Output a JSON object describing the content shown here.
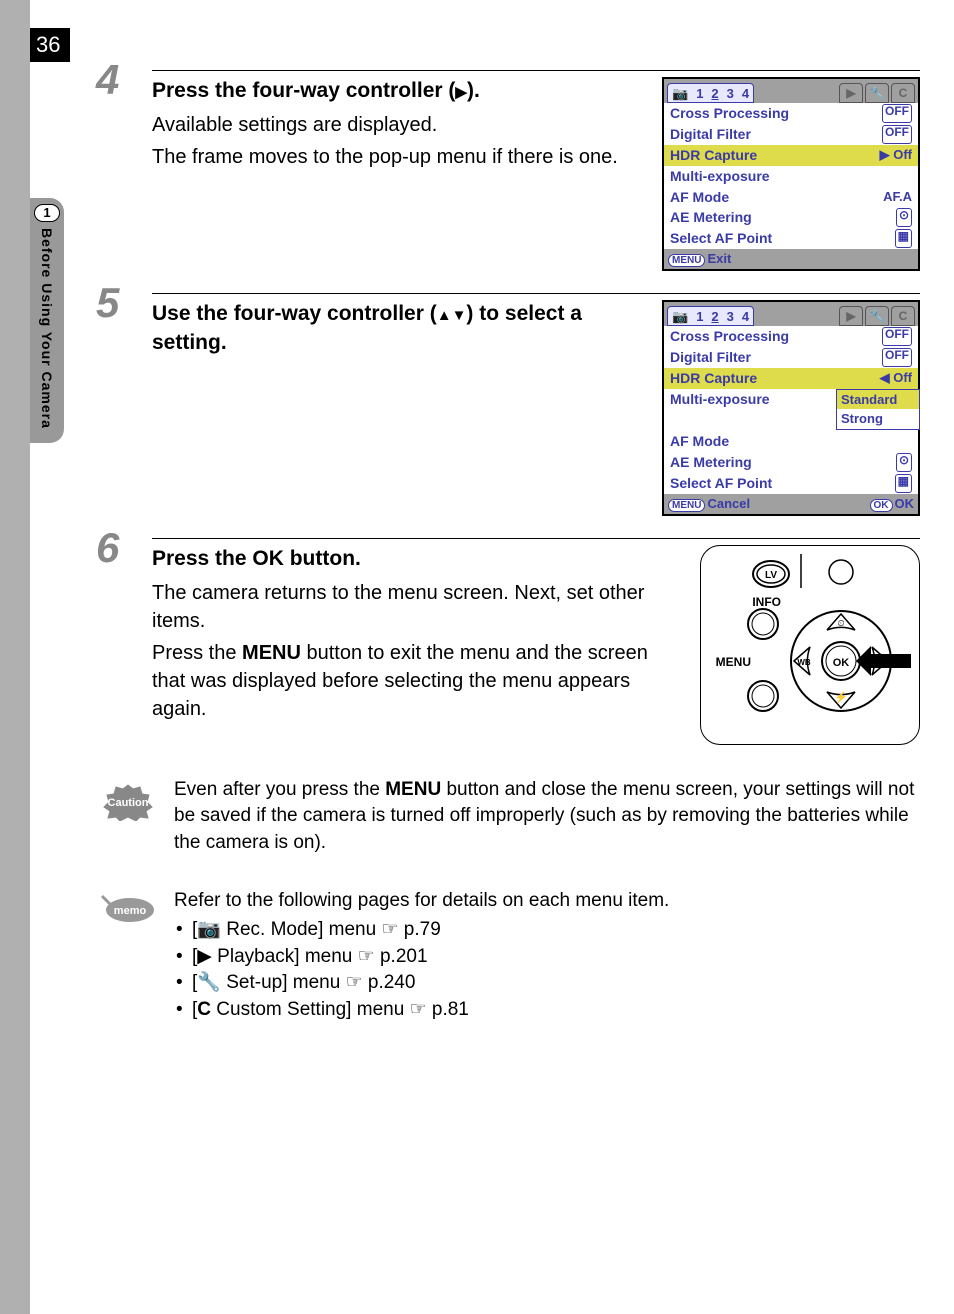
{
  "page_number": "36",
  "side_tab": {
    "section_number": "1",
    "label": "Before Using Your Camera"
  },
  "steps": [
    {
      "num": "4",
      "title_pre": "Press the four-way controller (",
      "title_arrow": "▶",
      "title_post": ").",
      "desc": [
        "Available settings are displayed.",
        "The frame moves to the pop-up menu if there is one."
      ],
      "menu": {
        "tabs": {
          "nums": [
            "1",
            "2",
            "3",
            "4"
          ],
          "selected": "2",
          "right_icons": [
            "▶",
            "🔧",
            "C"
          ]
        },
        "rows": [
          {
            "label": "Cross Processing",
            "value_icon": "OFF"
          },
          {
            "label": "Digital Filter",
            "value_icon": "OFF"
          },
          {
            "label": "HDR Capture",
            "value": "▶ Off",
            "hl": true
          },
          {
            "label": "Multi-exposure",
            "value": ""
          },
          {
            "label": "AF Mode",
            "value": "AF.A"
          },
          {
            "label": "AE Metering",
            "value_icon": "⊙"
          },
          {
            "label": "Select AF Point",
            "value_icon": "▦"
          }
        ],
        "footer_left_btn": "MENU",
        "footer_left": "Exit"
      }
    },
    {
      "num": "5",
      "title_pre": "Use the four-way controller (",
      "title_arrow": "▲▼",
      "title_post": ") to select a setting.",
      "menu": {
        "tabs": {
          "nums": [
            "1",
            "2",
            "3",
            "4"
          ],
          "selected": "2",
          "right_icons": [
            "▶",
            "🔧",
            "C"
          ]
        },
        "rows": [
          {
            "label": "Cross Processing",
            "value_icon": "OFF"
          },
          {
            "label": "Digital Filter",
            "value_icon": "OFF"
          },
          {
            "label": "HDR Capture",
            "value": "◀ Off",
            "hl": true
          },
          {
            "label": "Multi-exposure",
            "popup": [
              "Standard",
              "Strong"
            ],
            "popup_hl": 0
          },
          {
            "label": "AF Mode",
            "value": ""
          },
          {
            "label": "AE Metering",
            "value_icon": "⊙"
          },
          {
            "label": "Select AF Point",
            "value_icon": "▦"
          }
        ],
        "footer_left_btn": "MENU",
        "footer_left": "Cancel",
        "footer_right_btn": "OK",
        "footer_right": "OK"
      }
    },
    {
      "num": "6",
      "title_pre": "Press the ",
      "title_btn": "OK",
      "title_post": " button.",
      "desc": [
        "The camera returns to the menu screen. Next, set other items.",
        "Press the MENU button to exit the menu and the screen that was displayed before selecting the menu appears again."
      ],
      "diagram_labels": {
        "lv": "LV",
        "info": "INFO",
        "menu": "MENU",
        "ok": "OK",
        "wb": "WB"
      }
    }
  ],
  "caution": {
    "label": "Caution",
    "text_pre": "Even after you press the ",
    "text_btn": "MENU",
    "text_post": " button and close the menu screen, your settings will not be saved if the camera is turned off improperly (such as by removing the batteries while the camera is on)."
  },
  "memo": {
    "label": "memo",
    "intro": "Refer to the following pages for details on each menu item.",
    "items": [
      {
        "icon": "📷",
        "label": " Rec. Mode] menu ",
        "page": "p.79"
      },
      {
        "icon": "▶",
        "label": " Playback] menu ",
        "page": "p.201"
      },
      {
        "icon": "🔧",
        "label": " Set-up] menu ",
        "page": "p.240"
      },
      {
        "icon": "C",
        "label": " Custom Setting] menu ",
        "page": "p.81"
      }
    ]
  }
}
